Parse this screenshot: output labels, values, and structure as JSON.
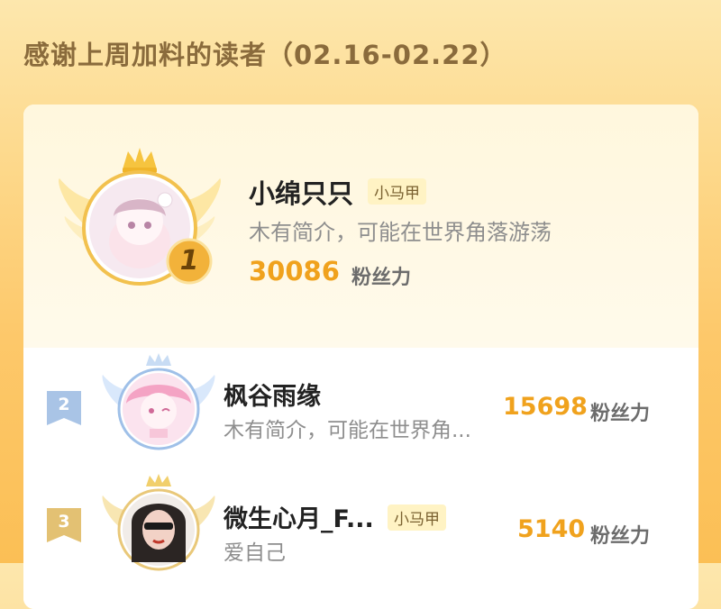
{
  "header": {
    "title": "感谢上周加料的读者（02.16-02.22）"
  },
  "unit_label": "粉丝力",
  "readers": [
    {
      "rank": "1",
      "name": "小绵只只",
      "badge": "小马甲",
      "description": "木有简介，可能在世界角落游荡",
      "score": "30086",
      "ring_color": "#f2c14e",
      "wing_color": "#fde7a4"
    },
    {
      "rank": "2",
      "name": "枫谷雨缘",
      "badge": "",
      "description": "木有简介，可能在世界角...",
      "score": "15698",
      "ring_color": "#9fc0e8",
      "wing_color": "#d9e8fb"
    },
    {
      "rank": "3",
      "name": "微生心月_F...",
      "badge": "小马甲",
      "description": "爱自己",
      "score": "5140",
      "ring_color": "#e9c879",
      "wing_color": "#f8e6b2"
    }
  ]
}
